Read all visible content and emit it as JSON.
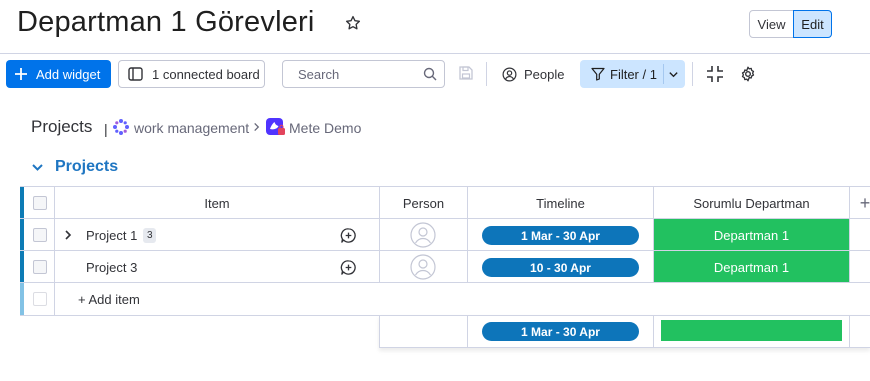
{
  "header": {
    "title": "Departman 1 Görevleri",
    "view_label": "View",
    "edit_label": "Edit"
  },
  "toolbar": {
    "add_widget_label": "Add widget",
    "connected_board_label": "1 connected board",
    "search_placeholder": "Search",
    "people_label": "People",
    "filter_label": "Filter / 1"
  },
  "breadcrumb": {
    "title": "Projects",
    "separator": "|",
    "workspace": "work management",
    "board": "Mete Demo"
  },
  "group": {
    "title": "Projects",
    "color": "#1f76c2"
  },
  "table": {
    "columns": {
      "item": "Item",
      "person": "Person",
      "timeline": "Timeline",
      "department": "Sorumlu Departman",
      "add": "+"
    },
    "rows": [
      {
        "name": "Project 1",
        "subitems": "3",
        "timeline": "1 Mar - 30 Apr",
        "department": "Departman 1"
      },
      {
        "name": "Project 3",
        "subitems": "",
        "timeline": "10 - 30 Apr",
        "department": "Departman 1"
      }
    ],
    "add_item_label": "+ Add item",
    "summary": {
      "timeline": "1 Mar - 30 Apr"
    }
  },
  "colors": {
    "primary": "#0073ea",
    "status_green": "#22c160",
    "timeline_blue": "#0d75ba",
    "filter_bg": "#cce5ff"
  }
}
